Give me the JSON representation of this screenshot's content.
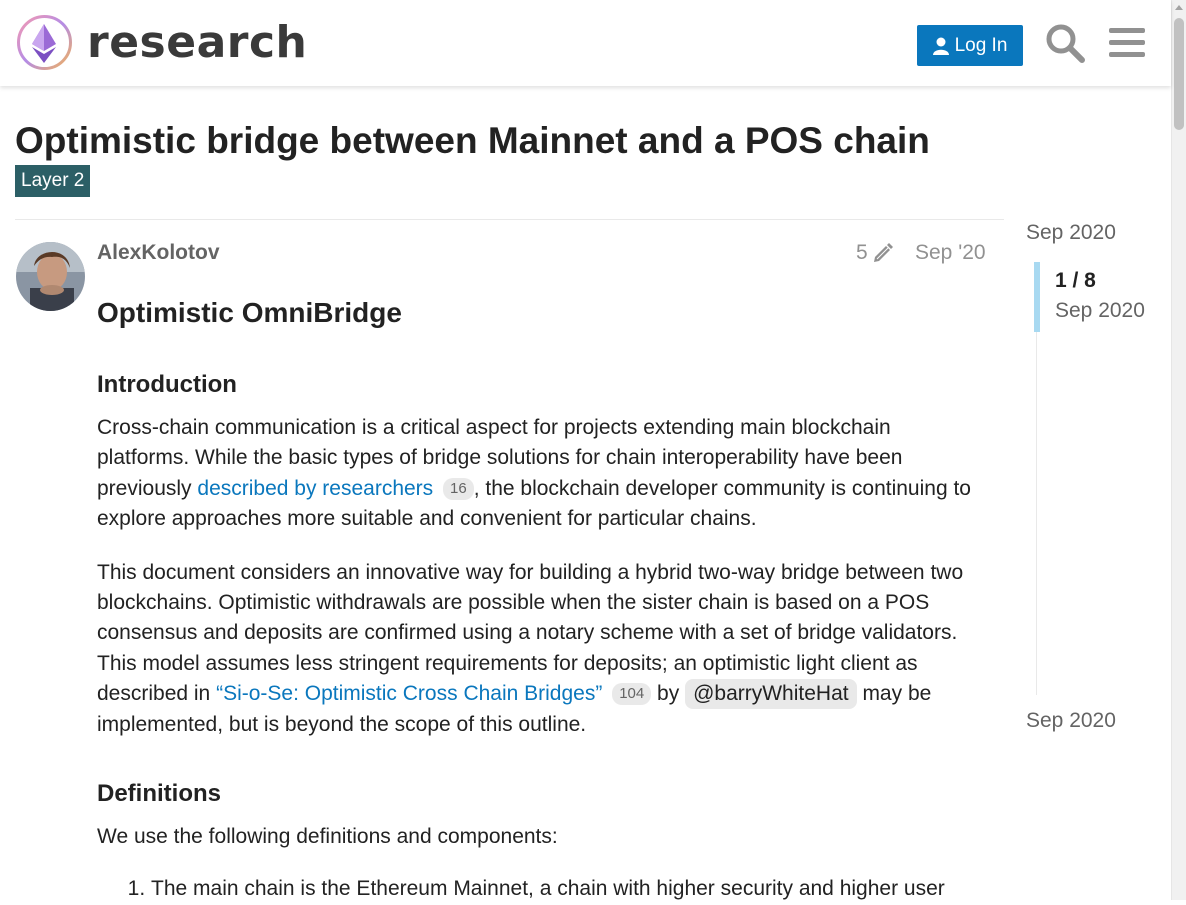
{
  "header": {
    "site_name": "research",
    "login_label": "Log In"
  },
  "topic": {
    "title": "Optimistic bridge between Mainnet and a POS chain",
    "category": "Layer 2"
  },
  "post": {
    "username": "AlexKolotov",
    "edit_count": "5",
    "date": "Sep '20",
    "heading": "Optimistic OmniBridge",
    "section1_heading": "Introduction",
    "p1_part1": "Cross-chain communication is a critical aspect for projects extending main blockchain platforms. While the basic types of bridge solutions for chain interoperability have been previously ",
    "p1_link": "described by researchers",
    "p1_link_count": "16",
    "p1_part2": ", the blockchain developer community is continuing to explore approaches more suitable and convenient for particular chains.",
    "p2_part1": "This document considers an innovative way for building a hybrid two-way bridge between two blockchains. Optimistic withdrawals are possible when the sister chain is based on a POS consensus and deposits are confirmed using a notary scheme with a set of bridge validators. This model assumes less stringent requirements for deposits; an optimistic light client as described in ",
    "p2_link": "“Si-o-Se: Optimistic Cross Chain Bridges”",
    "p2_link_count": "104",
    "p2_by": " by ",
    "p2_mention": "@barryWhiteHat",
    "p2_part2": " may be implemented, but is beyond the scope of this outline.",
    "section2_heading": "Definitions",
    "p3": "We use the following definitions and components:",
    "list_item_1": "The main chain is the Ethereum Mainnet, a chain with higher security and higher user"
  },
  "timeline": {
    "top_date": "Sep 2020",
    "position": "1 / 8",
    "position_date": "Sep 2020",
    "bottom_date": "Sep 2020"
  },
  "colors": {
    "accent": "#0a77bd",
    "category": "#2c5f66",
    "timeline_handle": "#a8d9f1"
  },
  "icons": [
    "logo-icon",
    "user-icon",
    "search-icon",
    "hamburger-menu-icon",
    "pencil-icon"
  ]
}
